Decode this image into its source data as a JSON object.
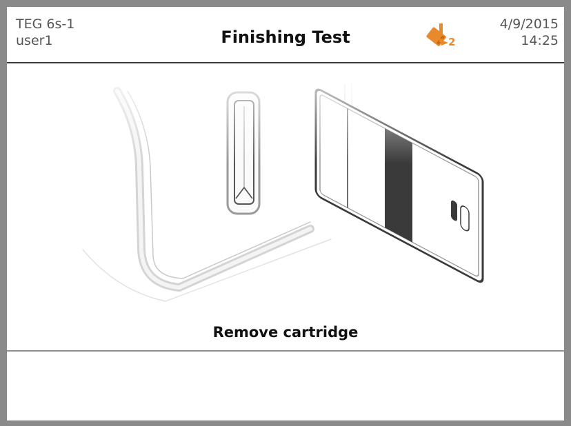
{
  "header": {
    "device_name": "TEG 6s-1",
    "user_name": "user1",
    "title": "Finishing Test",
    "date": "4/9/2015",
    "time": "14:25",
    "status_icon": {
      "name": "cartridge-alert-icon",
      "badge_text": "2",
      "color": "#e8892c"
    }
  },
  "main": {
    "illustration": "cartridge-removal-illustration",
    "instruction": "Remove cartridge"
  },
  "colors": {
    "frame": "#8a8a8a",
    "accent": "#e8892c",
    "cartridge_stripe": "#3a3a3a"
  }
}
